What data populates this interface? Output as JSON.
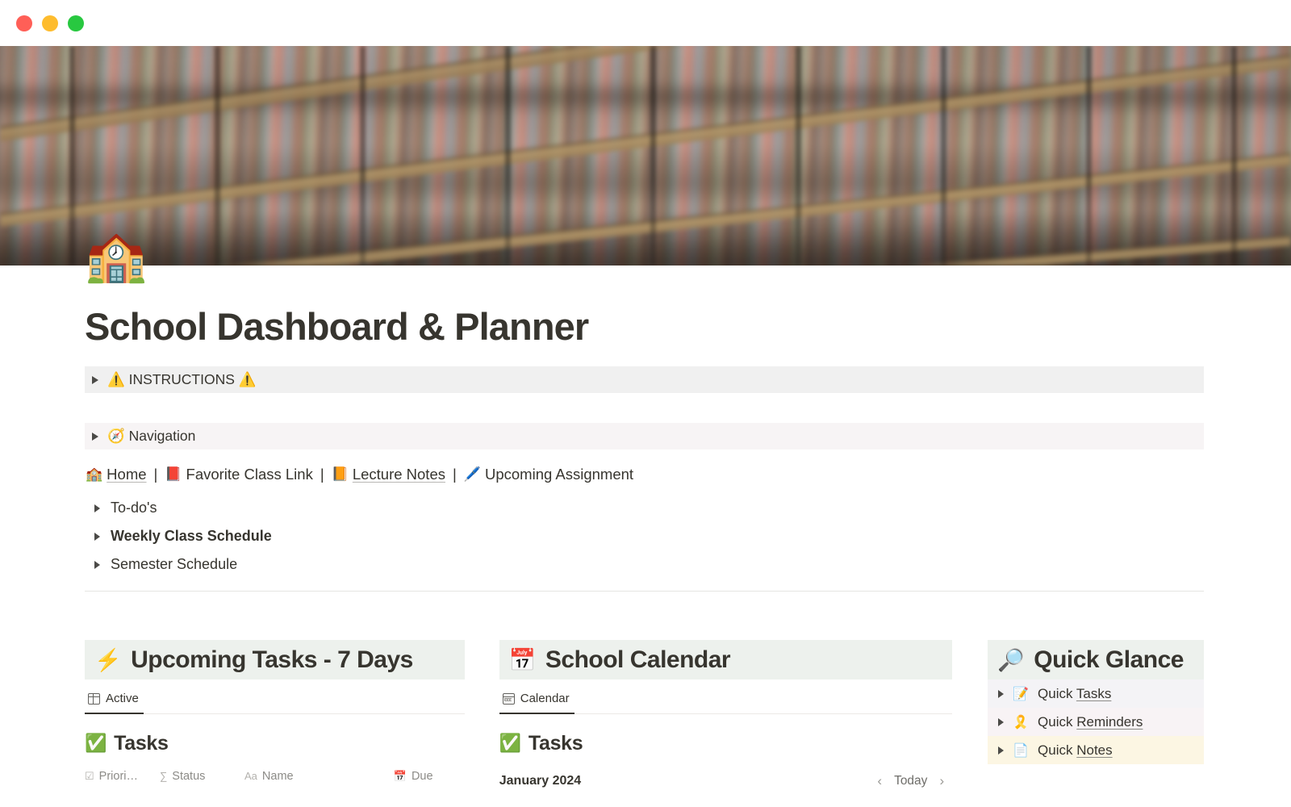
{
  "window": {
    "traffic_lights": [
      {
        "name": "close",
        "color": "#ff5f57"
      },
      {
        "name": "minimize",
        "color": "#febc2e"
      },
      {
        "name": "maximize",
        "color": "#28c840"
      }
    ]
  },
  "banner": {
    "alt": "blurred library bookshelves"
  },
  "page": {
    "icon": "🏫",
    "title": "School Dashboard & Planner"
  },
  "toggles": {
    "instructions": {
      "label": "⚠️ INSTRUCTIONS ⚠️"
    },
    "navigation": {
      "label": "🧭 Navigation"
    }
  },
  "linkrow": {
    "items": [
      {
        "emoji": "🏫",
        "label": "Home",
        "link": true
      },
      {
        "emoji": "📕",
        "label": "Favorite Class Link",
        "link": false
      },
      {
        "emoji": "📙",
        "label": "Lecture Notes",
        "link": true
      },
      {
        "emoji": "🖊️",
        "label": "Upcoming Assignment",
        "link": false
      }
    ],
    "separator": "|"
  },
  "sub_toggles": [
    {
      "label": "To-do's",
      "bold": false
    },
    {
      "label": "Weekly Class Schedule",
      "bold": true
    },
    {
      "label": "Semester Schedule",
      "bold": false
    }
  ],
  "columns": {
    "tasks": {
      "header_emoji": "⚡",
      "header_title": "Upcoming Tasks - 7 Days",
      "view_tab": "Active",
      "db_emoji": "✅",
      "db_title": "Tasks",
      "table_headers": [
        {
          "icon": "☑",
          "label": "Priori…"
        },
        {
          "icon": "∑",
          "label": "Status"
        },
        {
          "icon": "Aa",
          "label": "Name"
        },
        {
          "icon": "📅",
          "label": "Due"
        }
      ]
    },
    "calendar": {
      "header_emoji": "📅",
      "header_title": "School Calendar",
      "view_tab": "Calendar",
      "db_emoji": "✅",
      "db_title": "Tasks",
      "month": "January 2024",
      "prev_label": "‹",
      "today_label": "Today",
      "next_label": "›"
    },
    "glance": {
      "header_emoji": "🔎",
      "header_title": "Quick Glance",
      "rows": [
        {
          "emoji": "📝",
          "prefix": "Quick ",
          "link": "Tasks",
          "bg": "#f4f3f6"
        },
        {
          "emoji": "🎗️",
          "prefix": "Quick ",
          "link": "Reminders",
          "bg": "#f8f3f5"
        },
        {
          "emoji": "📄",
          "prefix": "Quick ",
          "link": "Notes",
          "bg": "#fcf6e3"
        }
      ]
    }
  }
}
